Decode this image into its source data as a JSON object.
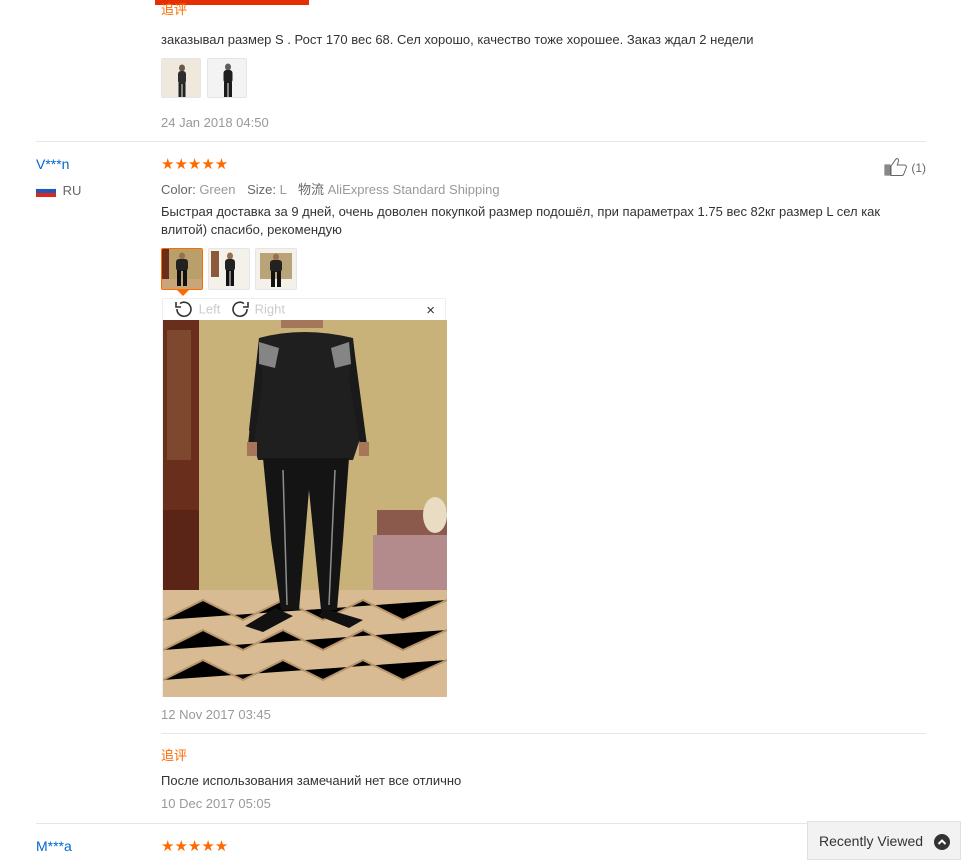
{
  "review_prev": {
    "followup_label": "追评",
    "text": "заказывал размер S . Рост 170 вес 68. Сел хорошо, качество тоже хорошее. Заказ ждал 2 недели",
    "date": "24 Jan 2018 04:50"
  },
  "review_main": {
    "username": "V***n",
    "country": "RU",
    "stars": "★★★★★",
    "color_label": "Color:",
    "color_value": "Green",
    "size_label": "Size:",
    "size_value": "L",
    "shipping_label": "物流",
    "shipping_value": "AliExpress Standard Shipping",
    "like_count": "(1)",
    "text": "Быстрая доставка за 9 дней, очень доволен покупкой размер подошёл, при параметрах 1.75 вес 82кг размер L сел как влитой) спасибо, рекомендую",
    "viewer": {
      "rotate_left": "Left",
      "rotate_right": "Right",
      "close": "×"
    },
    "date": "12 Nov 2017 03:45",
    "followup_label": "追评",
    "followup_text": "После использования замечаний нет все отлично",
    "followup_date": "10 Dec 2017 05:05"
  },
  "review_next": {
    "username": "M***a",
    "stars": "★★★★★"
  },
  "recently_viewed": {
    "label": "Recently Viewed"
  },
  "colors": {
    "accent": "#ff6a00",
    "brand_red": "#e62e04",
    "link_blue": "#0066cc"
  }
}
